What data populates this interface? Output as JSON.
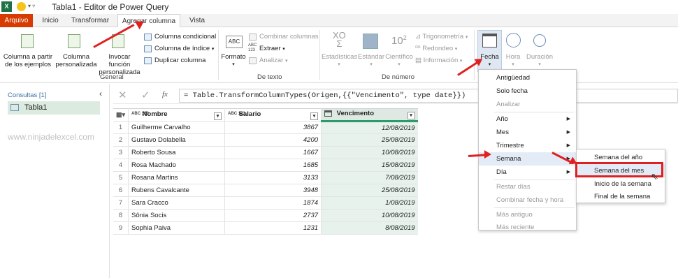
{
  "window": {
    "title": "Tabla1 - Editor de Power Query"
  },
  "tabs": [
    {
      "label": "Arquivo"
    },
    {
      "label": "Inicio"
    },
    {
      "label": "Transformar"
    },
    {
      "label": "Agregar columna"
    },
    {
      "label": "Vista"
    }
  ],
  "ribbon": {
    "general": {
      "col_from_examples": [
        "Columna a partir",
        "de los ejemplos"
      ],
      "custom_column": [
        "Columna",
        "personalizada"
      ],
      "invoke_function": [
        "Invocar función",
        "personalizada"
      ],
      "conditional_column": "Columna condicional",
      "index_column": "Columna de índice",
      "duplicate_column": "Duplicar columna",
      "group_label": "General"
    },
    "text": {
      "format": "Formato",
      "merge_columns": "Combinar columnas",
      "extract": "Extraer",
      "parse": "Analizar",
      "abc": "ABC",
      "abc123": "ABC 123",
      "group_label": "De texto"
    },
    "number": {
      "statistics": "Estadísticas",
      "standard": "Estándar",
      "scientific": "Científico",
      "trigonometry": "Trigonometría",
      "rounding": "Redondeo",
      "information": "Información",
      "sigma_glyph": "XO\nΣ",
      "power_glyph": "10",
      "power_exp": "2",
      "group_label": "De número"
    },
    "date": {
      "date": "Fecha",
      "time": "Hora",
      "duration": "Duración"
    }
  },
  "queries": {
    "header": "Consultas [1]",
    "items": [
      "Tabla1"
    ],
    "watermark": "www.ninjadelexcel.com"
  },
  "formula": {
    "fx": "fx",
    "text": "= Table.TransformColumnTypes(Origen,{{\"Vencimento\", type date}})"
  },
  "table": {
    "headers": [
      {
        "type": "ABC 123",
        "name": "Nombre"
      },
      {
        "type": "ABC 123",
        "name": "Salario"
      },
      {
        "type": "",
        "name": "Vencimento"
      }
    ],
    "rows": [
      [
        "1",
        "Guilherme Carvalho",
        "3867",
        "12/08/2019"
      ],
      [
        "2",
        "Gustavo Dolabella",
        "4200",
        "25/08/2019"
      ],
      [
        "3",
        "Roberto Sousa",
        "1667",
        "10/08/2019"
      ],
      [
        "4",
        "Rosa Machado",
        "1685",
        "15/08/2019"
      ],
      [
        "5",
        "Rosana Martins",
        "3133",
        "7/08/2019"
      ],
      [
        "6",
        "Rubens Cavalcante",
        "3948",
        "25/08/2019"
      ],
      [
        "7",
        "Sara Cracco",
        "1874",
        "1/08/2019"
      ],
      [
        "8",
        "Sônia Socis",
        "2737",
        "10/08/2019"
      ],
      [
        "9",
        "Sophia Paiva",
        "1231",
        "8/08/2019"
      ]
    ]
  },
  "date_menu": [
    {
      "label": "Antigüedad",
      "disabled": false,
      "sub": false
    },
    {
      "label": "Solo fecha",
      "disabled": false,
      "sub": false
    },
    {
      "label": "Analizar",
      "disabled": true,
      "sub": false
    },
    {
      "label": "Año",
      "disabled": false,
      "sub": true
    },
    {
      "label": "Mes",
      "disabled": false,
      "sub": true
    },
    {
      "label": "Trimestre",
      "disabled": false,
      "sub": true
    },
    {
      "label": "Semana",
      "disabled": false,
      "sub": true
    },
    {
      "label": "Día",
      "disabled": false,
      "sub": true
    },
    {
      "label": "Restar días",
      "disabled": true,
      "sub": false
    },
    {
      "label": "Combinar fecha y hora",
      "disabled": true,
      "sub": false
    },
    {
      "label": "Más antiguo",
      "disabled": true,
      "sub": false
    },
    {
      "label": "Más reciente",
      "disabled": true,
      "sub": false
    }
  ],
  "week_menu": [
    {
      "label": "Semana del año"
    },
    {
      "label": "Semana del mes"
    },
    {
      "label": "Inicio de la semana"
    },
    {
      "label": "Final de la semana"
    }
  ],
  "colors": {
    "file_tab": "#d83b01",
    "date_col_bg": "#e6f2eb",
    "highlight_box": "#e02020"
  }
}
